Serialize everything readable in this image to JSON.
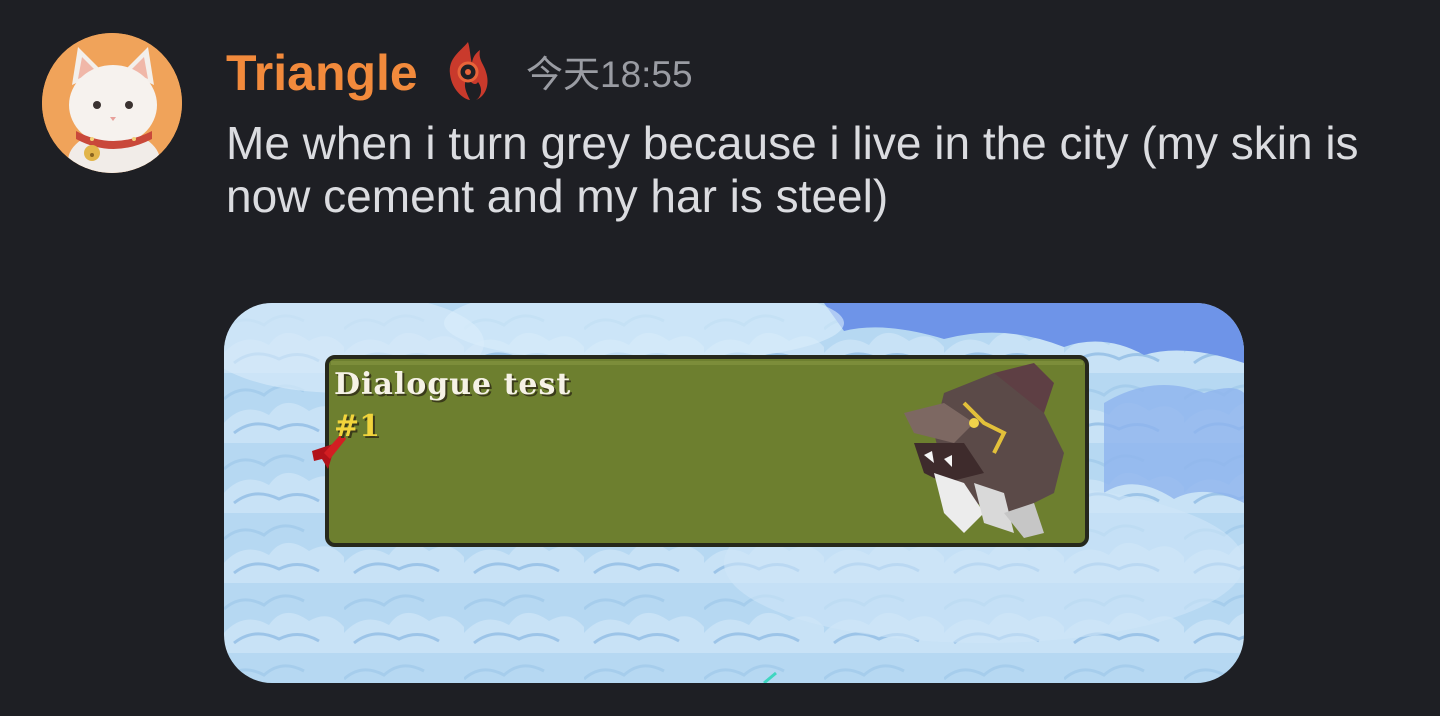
{
  "message": {
    "author": {
      "name": "Triangle",
      "name_color": "#f28a3c",
      "avatar_icon": "cat-avatar-icon",
      "badge_icon": "flame-badge-icon"
    },
    "timestamp": "今天18:55",
    "text": "Me when i turn grey because i live in the city (my skin is now cement and my har is steel)",
    "attachment": {
      "type": "image",
      "dialogue_title": "Dialogue test",
      "dialogue_subtitle": "#1",
      "dialogue_box_color": "#6d7f2f",
      "sky_color": "#a9d0f0"
    }
  }
}
